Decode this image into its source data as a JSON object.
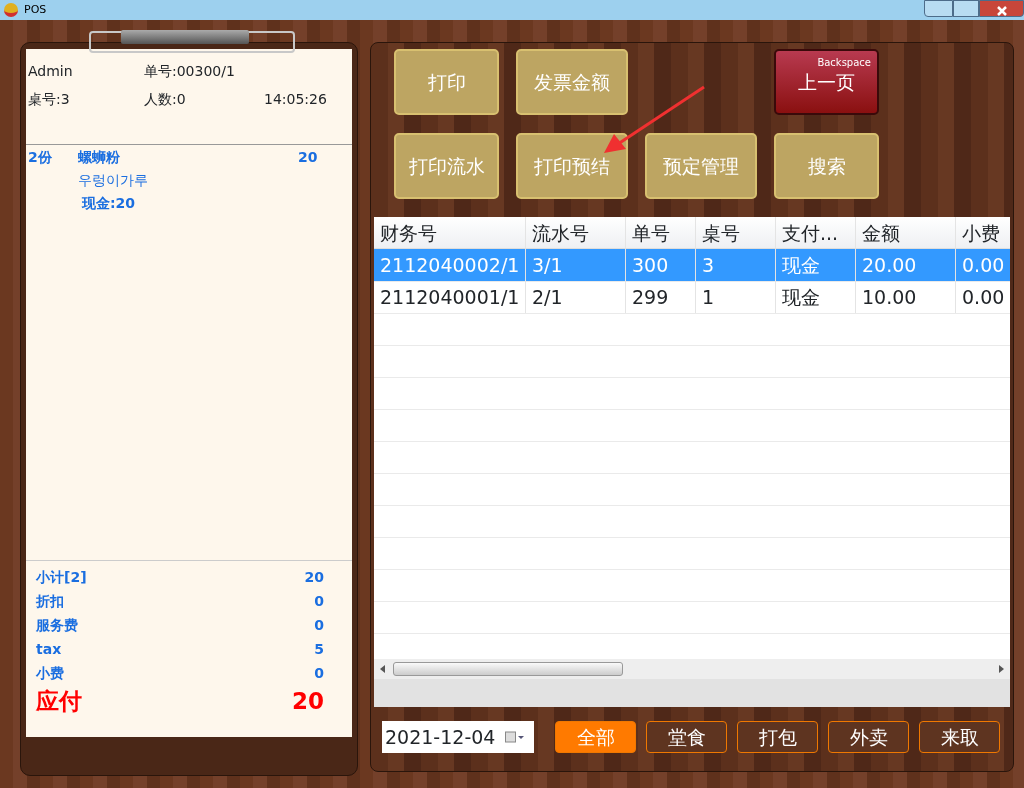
{
  "window": {
    "title": "POS"
  },
  "ticket": {
    "user": "Admin",
    "order_no": "单号:00300/1",
    "table_no": "桌号:3",
    "guests": "人数:0",
    "time": "14:05:26",
    "items": [
      {
        "qty": "2份",
        "name": "螺蛳粉",
        "price": "20",
        "name_alt": "우렁이가루",
        "payment": "现金:20"
      }
    ],
    "summary": [
      {
        "label": "小计[2]",
        "value": "20"
      },
      {
        "label": "折扣",
        "value": "0"
      },
      {
        "label": "服务费",
        "value": "0"
      },
      {
        "label": "tax",
        "value": "5"
      },
      {
        "label": "小费",
        "value": "0"
      }
    ],
    "due": {
      "label": "应付",
      "value": "20"
    }
  },
  "actions": [
    {
      "label": "打印",
      "kind": "normal"
    },
    {
      "label": "发票金额",
      "kind": "normal"
    },
    {
      "label": "上一页",
      "kind": "back",
      "hint": "Backspace"
    },
    {
      "label": "打印流水",
      "kind": "normal"
    },
    {
      "label": "打印预结",
      "kind": "normal"
    },
    {
      "label": "预定管理",
      "kind": "normal"
    },
    {
      "label": "搜索",
      "kind": "normal"
    }
  ],
  "table": {
    "columns": [
      "财务号",
      "流水号",
      "单号",
      "桌号",
      "支付...",
      "金额",
      "小费"
    ],
    "rows": [
      {
        "selected": true,
        "cells": [
          "2112040002/1",
          "3/1",
          "300",
          "3",
          "现金",
          "20.00",
          "0.00"
        ]
      },
      {
        "selected": false,
        "cells": [
          "2112040001/1",
          "2/1",
          "299",
          "1",
          "现金",
          "10.00",
          "0.00"
        ]
      }
    ]
  },
  "date": "2021-12-04",
  "filters": [
    {
      "label": "全部",
      "selected": true
    },
    {
      "label": "堂食",
      "selected": false
    },
    {
      "label": "打包",
      "selected": false
    },
    {
      "label": "外卖",
      "selected": false
    },
    {
      "label": "来取",
      "selected": false
    }
  ]
}
